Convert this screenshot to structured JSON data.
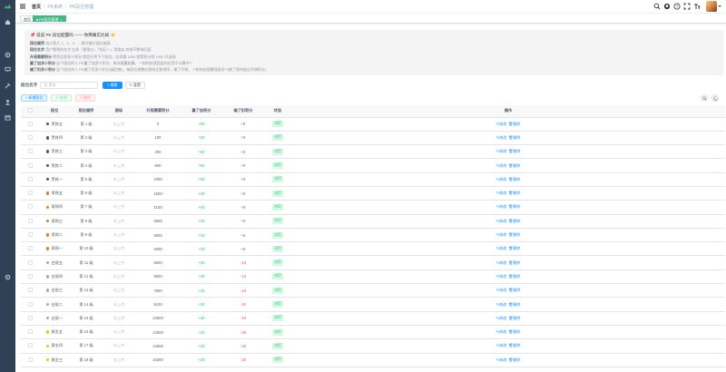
{
  "navbar": {
    "breadcrumb": [
      "首页",
      "PK系统",
      "PK段位管理"
    ]
  },
  "tags": {
    "home": "首页",
    "active": "PK段位管理"
  },
  "notice": {
    "title": "📌 说说 PK 段位配置吗 —— 你用确实比如 👈",
    "lines": [
      {
        "label": "段位顺序",
        "text": "由小到大 1、2、3……数字越大段位越高"
      },
      {
        "label": "段位名字",
        "text": "用户看到的名字 比如「黄铜五」「钻石一」用类似 其他不影响匹配"
      },
      {
        "label": "升段需要积分",
        "text": "累积达到多少积分 就会升到下个段位。比如填 1000 就是积分到 1000 升这档"
      },
      {
        "label": "赢了加多少积分",
        "text": "这个段位的人 PK赢了加多少积分，每次输赢结算。 **如何处理奖励内位用于计算中**"
      },
      {
        "label": "输了扣多少积分",
        "text": "这个段位的人 PK输了扣多少积分(填负数)，每段位调整应保持正数排序，输了不掉。 **如何处理最强段位**(输了保持段位不掉积分)"
      }
    ]
  },
  "search": {
    "label": "段位名字",
    "placeholder": "段 置单",
    "search_btn": "搜索",
    "reset_btn": "重置"
  },
  "toolbar": {
    "add": "新增段位",
    "edit": "修改",
    "delete": "删除"
  },
  "table": {
    "headers": [
      "",
      "段位",
      "段位顺序",
      "图标",
      "升段需要积分",
      "赢了加积分",
      "输了扣积分",
      "状态",
      "操作"
    ],
    "edit_label": "修改",
    "delete_label": "删除",
    "rows": [
      {
        "name": "黑铁五",
        "color": "#555555",
        "order": "第 1 级",
        "icon": "未上传",
        "need": "0",
        "win": "+60",
        "lose": "+0",
        "status": "启用"
      },
      {
        "name": "黑铁四",
        "color": "#555555",
        "order": "第 2 级",
        "icon": "未上传",
        "need": "100",
        "win": "+60",
        "lose": "+0",
        "status": "启用"
      },
      {
        "name": "黑铁三",
        "color": "#555555",
        "order": "第 3 级",
        "icon": "未上传",
        "need": "300",
        "win": "+60",
        "lose": "+0",
        "status": "启用"
      },
      {
        "name": "黑铁二",
        "color": "#555555",
        "order": "第 4 级",
        "icon": "未上传",
        "need": "600",
        "win": "+50",
        "lose": "+0",
        "status": "启用"
      },
      {
        "name": "黑铁一",
        "color": "#555555",
        "order": "第 5 级",
        "icon": "未上传",
        "need": "1000",
        "win": "+50",
        "lose": "+0",
        "status": "启用"
      },
      {
        "name": "青铜五",
        "color": "#e67e22",
        "order": "第 6 级",
        "icon": "未上传",
        "need": "1500",
        "win": "+40",
        "lose": "+0",
        "status": "启用"
      },
      {
        "name": "青铜四",
        "color": "#e67e22",
        "order": "第 7 级",
        "icon": "未上传",
        "need": "2100",
        "win": "+40",
        "lose": "+0",
        "status": "启用"
      },
      {
        "name": "青铜三",
        "color": "#e67e22",
        "order": "第 8 级",
        "icon": "未上传",
        "need": "2800",
        "win": "+40",
        "lose": "+0",
        "status": "启用"
      },
      {
        "name": "青铜二",
        "color": "#e67e22",
        "order": "第 9 级",
        "icon": "未上传",
        "need": "3600",
        "win": "+40",
        "lose": "+0",
        "status": "启用"
      },
      {
        "name": "青铜一",
        "color": "#e67e22",
        "order": "第 10 级",
        "icon": "未上传",
        "need": "4500",
        "win": "+40",
        "lose": "+0",
        "status": "启用"
      },
      {
        "name": "白银五",
        "color": "#aaaaaa",
        "order": "第 11 级",
        "icon": "未上传",
        "need": "5500",
        "win": "+30",
        "lose": "-10",
        "status": "启用"
      },
      {
        "name": "白银四",
        "color": "#aaaaaa",
        "order": "第 12 级",
        "icon": "未上传",
        "need": "6600",
        "win": "+30",
        "lose": "-10",
        "status": "启用"
      },
      {
        "name": "白银三",
        "color": "#aaaaaa",
        "order": "第 13 级",
        "icon": "未上传",
        "need": "7800",
        "win": "+30",
        "lose": "-10",
        "status": "启用"
      },
      {
        "name": "白银二",
        "color": "#aaaaaa",
        "order": "第 14 级",
        "icon": "未上传",
        "need": "9100",
        "win": "+30",
        "lose": "-10",
        "status": "启用"
      },
      {
        "name": "白银一",
        "color": "#aaaaaa",
        "order": "第 15 级",
        "icon": "未上传",
        "need": "10500",
        "win": "+30",
        "lose": "-10",
        "status": "启用"
      },
      {
        "name": "黄金五",
        "color": "#f1c40f",
        "order": "第 16 级",
        "icon": "未上传",
        "need": "12000",
        "win": "+20",
        "lose": "-20",
        "status": "启用"
      },
      {
        "name": "黄金四",
        "color": "#f1c40f",
        "order": "第 17 级",
        "icon": "未上传",
        "need": "13600",
        "win": "+20",
        "lose": "-20",
        "status": "启用"
      },
      {
        "name": "黄金三",
        "color": "#f1c40f",
        "order": "第 18 级",
        "icon": "未上传",
        "need": "15300",
        "win": "+20",
        "lose": "-20",
        "status": "启用"
      }
    ]
  }
}
